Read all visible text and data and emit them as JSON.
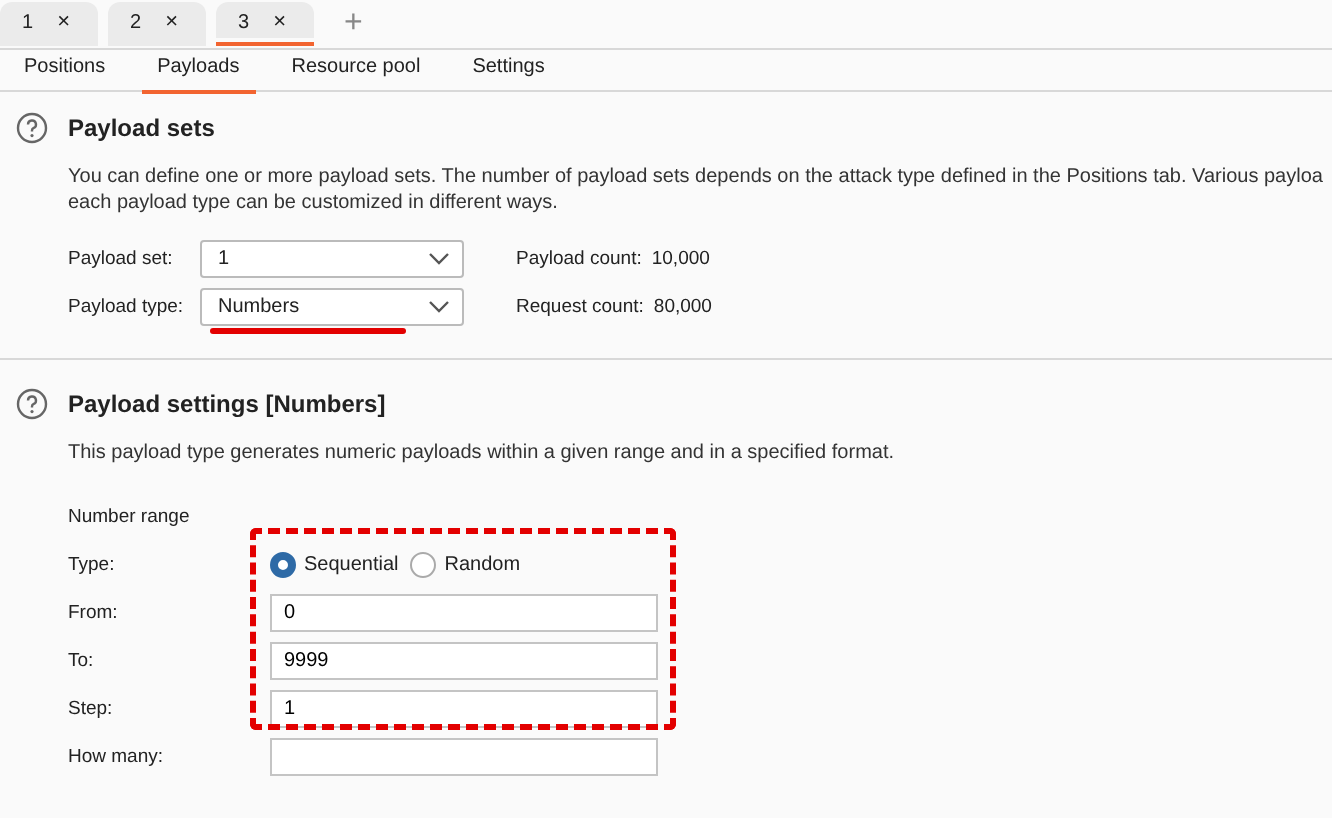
{
  "window_tabs": [
    {
      "label": "1",
      "selected": false
    },
    {
      "label": "2",
      "selected": false
    },
    {
      "label": "3",
      "selected": true
    }
  ],
  "new_tab": "+",
  "close_glyph": "×",
  "sub_tabs": [
    {
      "label": "Positions",
      "selected": false
    },
    {
      "label": "Payloads",
      "selected": true
    },
    {
      "label": "Resource pool",
      "selected": false
    },
    {
      "label": "Settings",
      "selected": false
    }
  ],
  "payload_sets": {
    "title": "Payload sets",
    "description": [
      "You can define one or more payload sets. The number of payload sets depends on the attack type defined in the Positions tab. Various payloa",
      "each payload type can be customized in different ways."
    ],
    "fields": [
      {
        "label": "Payload set:",
        "value": "1",
        "info_label": "Payload count:",
        "info_value": "10,000",
        "underlined": false
      },
      {
        "label": "Payload type:",
        "value": "Numbers",
        "info_label": "Request count:",
        "info_value": "80,000",
        "underlined": true
      }
    ]
  },
  "payload_settings": {
    "title": "Payload settings [Numbers]",
    "description": "This payload type generates numeric payloads within a given range and in a specified format.",
    "group_label": "Number range",
    "rows": [
      {
        "kind": "radio",
        "label": "Type:",
        "highlighted": true,
        "options": [
          {
            "label": "Sequential",
            "selected": true
          },
          {
            "label": "Random",
            "selected": false
          }
        ]
      },
      {
        "kind": "input",
        "label": "From:",
        "value": "0",
        "highlighted": true
      },
      {
        "kind": "input",
        "label": "To:",
        "value": "9999",
        "highlighted": true
      },
      {
        "kind": "input",
        "label": "Step:",
        "value": "1",
        "highlighted": true
      },
      {
        "kind": "input",
        "label": "How many:",
        "highlighted": false
      }
    ]
  }
}
